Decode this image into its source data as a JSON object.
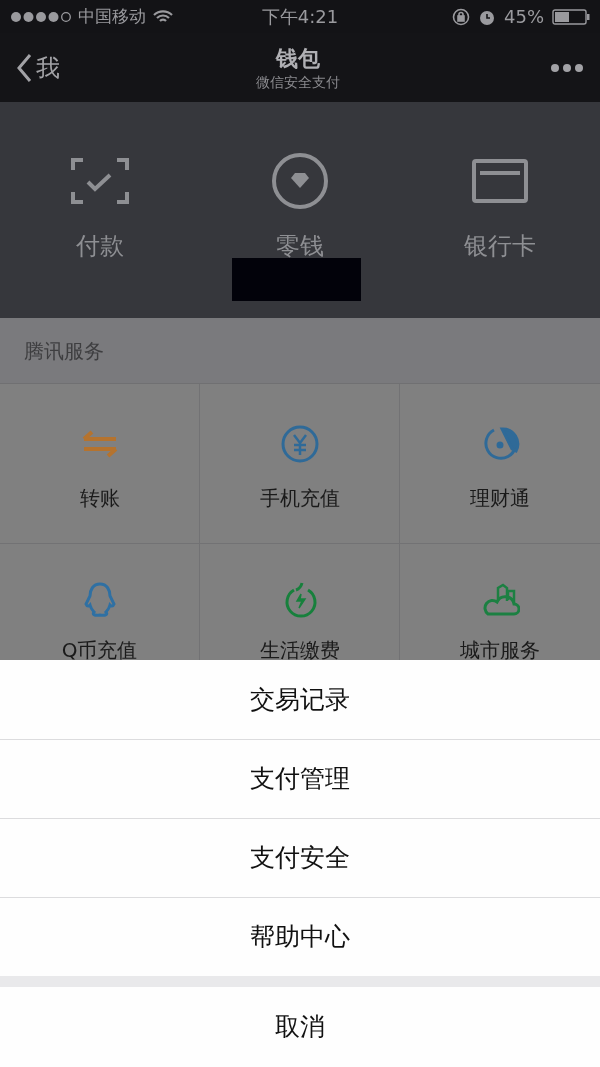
{
  "status_bar": {
    "carrier": "中国移动",
    "time": "下午4:21",
    "battery": "45%"
  },
  "nav": {
    "back": "我",
    "title": "钱包",
    "subtitle": "微信安全支付"
  },
  "wallet_actions": [
    {
      "label": "付款",
      "kind": "scan"
    },
    {
      "label": "零钱",
      "kind": "coin"
    },
    {
      "label": "银行卡",
      "kind": "card"
    }
  ],
  "section_title": "腾讯服务",
  "services": [
    {
      "label": "转账",
      "kind": "transfer",
      "color": "#b5732e"
    },
    {
      "label": "手机充值",
      "kind": "yuan",
      "color": "#2f6a98"
    },
    {
      "label": "理财通",
      "kind": "fish",
      "color": "#2f6a98"
    },
    {
      "label": "Q币充值",
      "kind": "penguin",
      "color": "#2f70a3"
    },
    {
      "label": "生活缴费",
      "kind": "power",
      "color": "#17803c"
    },
    {
      "label": "城市服务",
      "kind": "city",
      "color": "#1c8042"
    }
  ],
  "action_sheet": {
    "items": [
      "交易记录",
      "支付管理",
      "支付安全",
      "帮助中心"
    ],
    "cancel": "取消"
  }
}
